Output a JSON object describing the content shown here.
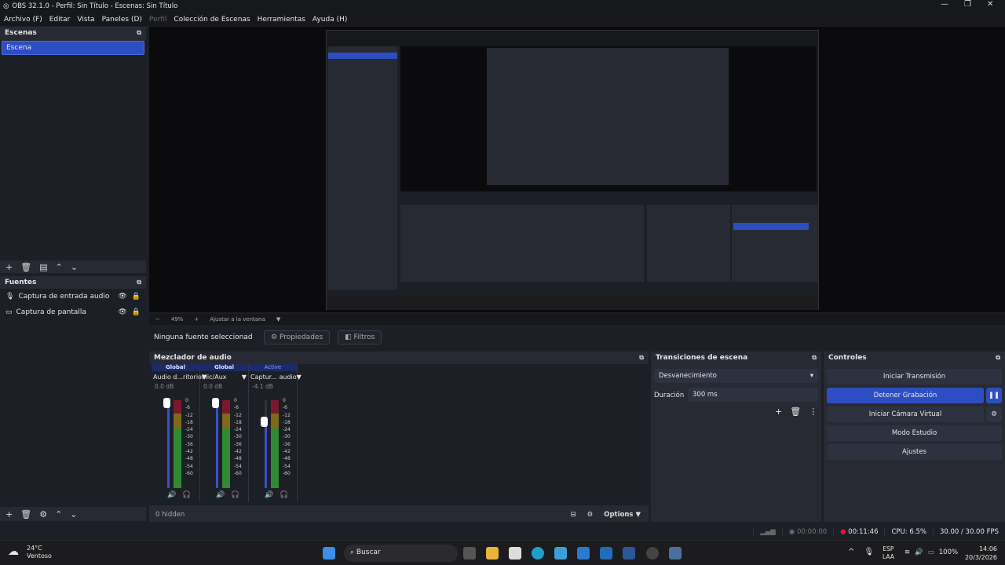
{
  "window": {
    "title": "OBS 32.1.0 - Perfil: Sin Título - Escenas: Sin Título",
    "min": "—",
    "max": "❐",
    "close": "✕"
  },
  "menu": [
    "Archivo (F)",
    "Editar",
    "Vista",
    "Paneles (D)",
    "Perfil",
    "Colección de Escenas",
    "Herramientas",
    "Ayuda (H)"
  ],
  "scenes": {
    "title": "Escenas",
    "items": [
      "Escena"
    ]
  },
  "sources": {
    "title": "Fuentes",
    "items": [
      "Captura de entrada audio",
      "Captura de pantalla"
    ]
  },
  "zoom": {
    "minus": "−",
    "value": "49%",
    "plus": "+",
    "fit": "Ajustar a la ventana"
  },
  "context": {
    "none": "Ninguna fuente seleccionad",
    "properties": "Propiedades",
    "filters": "Filtros"
  },
  "mixer": {
    "title": "Mezclador de audio",
    "hidden": "0 hidden",
    "options": "Options",
    "channels": [
      {
        "tag": "Global",
        "name": "Audio d...ritorio",
        "db": "0.0 dB",
        "level": 1.0
      },
      {
        "tag": "Global",
        "name": "Mic/Aux",
        "db": "0.0 dB",
        "level": 1.0
      },
      {
        "tag": "Active",
        "name": "Captur... audio",
        "db": "-4.1 dB",
        "level": 0.76
      }
    ],
    "ticks": [
      "0",
      "-6",
      "-12",
      "-18",
      "-24",
      "-30",
      "-36",
      "-42",
      "-48",
      "-54",
      "-60"
    ]
  },
  "transitions": {
    "title": "Transiciones de escena",
    "selected": "Desvanecimiento",
    "duration_label": "Duración",
    "duration": "300 ms"
  },
  "controls": {
    "title": "Controles",
    "buttons": [
      "Iniciar Transmisión",
      "Detener Grabación",
      "Iniciar Cámara Virtual",
      "Modo Estudio",
      "Ajustes"
    ]
  },
  "status": {
    "stream_time": "00:00:00",
    "rec_time": "00:11:46",
    "cpu": "CPU: 6.5%",
    "fps": "30.00 / 30.00 FPS"
  },
  "taskbar": {
    "temp": "24°C",
    "weather": "Ventoso",
    "search": "Buscar",
    "lang1": "ESP",
    "lang2": "LAA",
    "battery": "100%",
    "time": "14:06",
    "date": "20/3/2026"
  }
}
